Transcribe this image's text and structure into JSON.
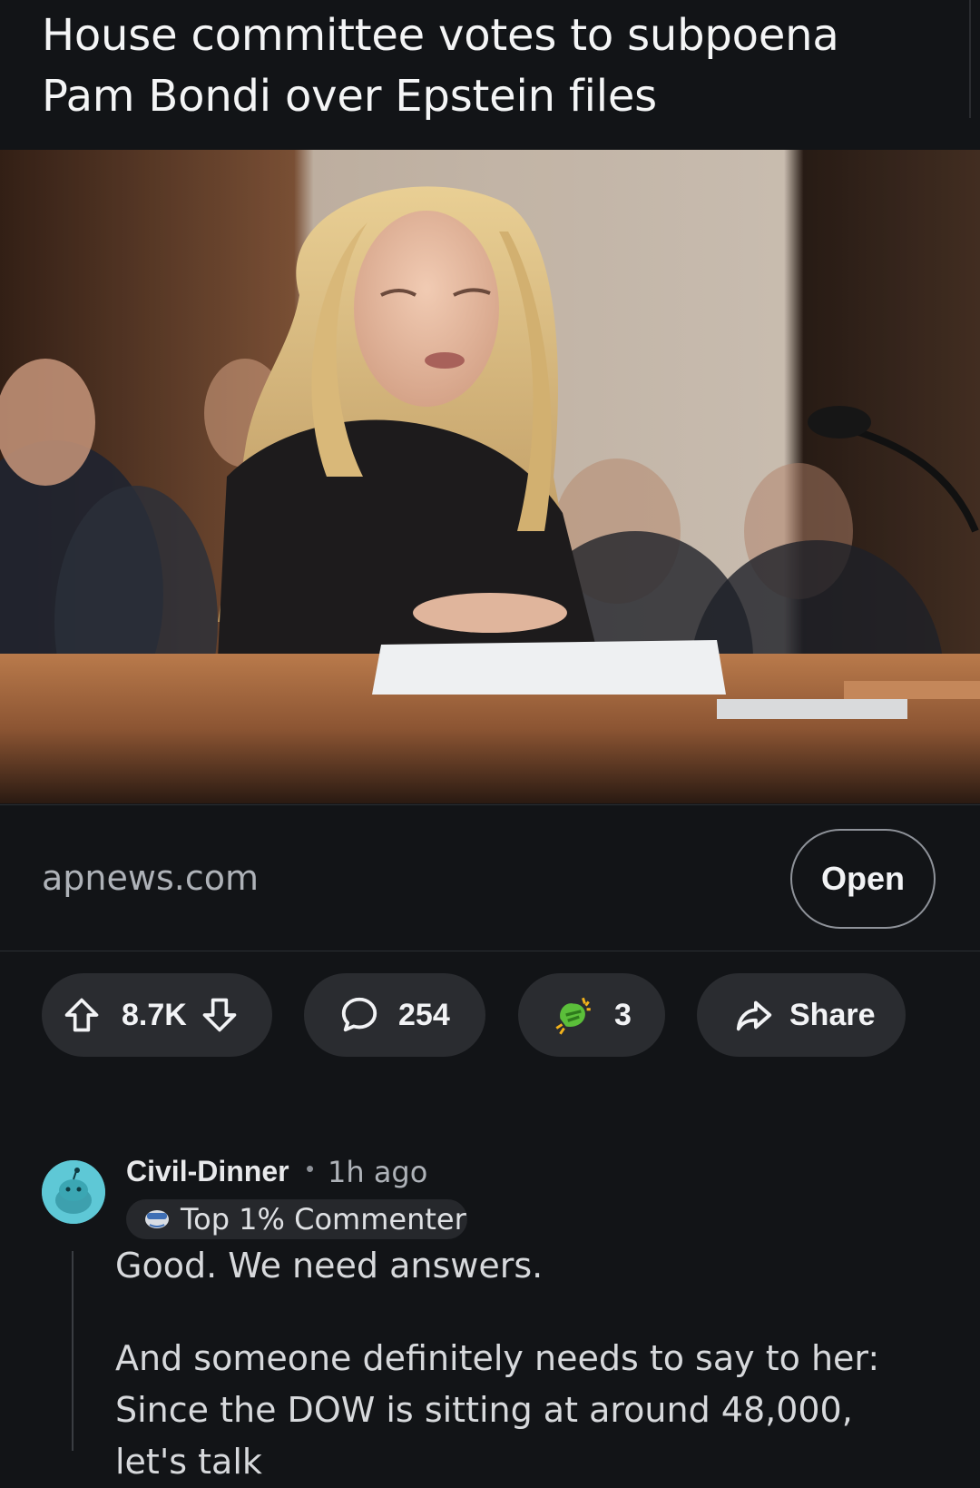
{
  "post": {
    "title": "House committee votes to subpoena Pam Bondi over Epstein files",
    "image_alt": "Woman with long blonde hair speaking at a hearing table",
    "link": {
      "domain": "apnews.com",
      "open_label": "Open"
    }
  },
  "actions": {
    "score": "8.7K",
    "comments": "254",
    "awards": "3",
    "share_label": "Share"
  },
  "comment": {
    "author": "Civil-Dinner",
    "separator": "•",
    "time": "1h ago",
    "flair": "Top 1% Commenter",
    "paragraphs": [
      "Good. We need answers.",
      "And someone definitely needs to say to her: Since the DOW is sitting at around 48,000, let's talk"
    ]
  },
  "colors": {
    "background": "#121417",
    "pill": "#2a2c30",
    "accent_avatar": "#5ec8d6"
  },
  "icons": [
    "upvote-icon",
    "downvote-icon",
    "comment-bubble-icon",
    "award-icon",
    "share-icon",
    "snoo-avatar-icon",
    "flair-icon"
  ]
}
